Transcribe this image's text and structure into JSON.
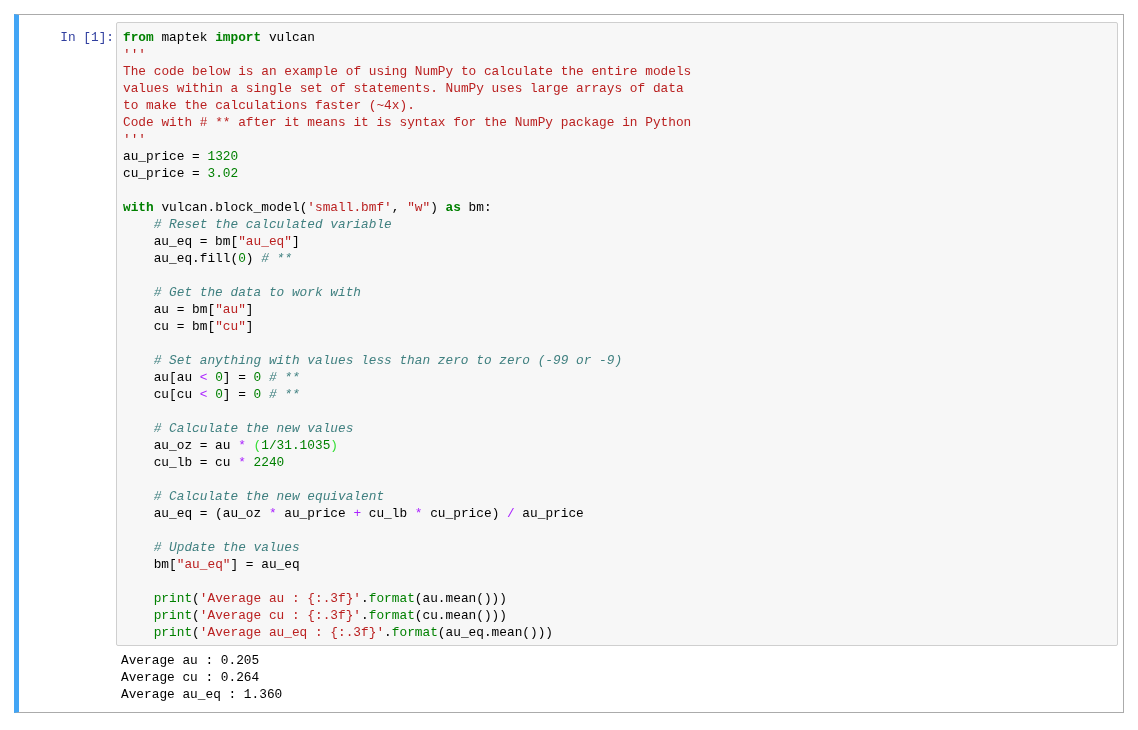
{
  "cell": {
    "prompt": "In [1]:",
    "code_blocks": [
      {
        "lines": [
          {
            "indented": false,
            "tokens": [
              {
                "kind": "keyword",
                "text": "from"
              },
              {
                "kind": "plain",
                "text": " maptek "
              },
              {
                "kind": "keyword",
                "text": "import"
              },
              {
                "kind": "plain",
                "text": " vulcan"
              }
            ]
          },
          {
            "indented": false,
            "tokens": [
              {
                "kind": "string",
                "text": "'''"
              }
            ]
          },
          {
            "indented": false,
            "tokens": [
              {
                "kind": "string",
                "text": "The code below is an example of using NumPy to calculate the entire models"
              }
            ]
          },
          {
            "indented": false,
            "tokens": [
              {
                "kind": "string",
                "text": "values within a single set of statements. NumPy uses large arrays of data"
              }
            ]
          },
          {
            "indented": false,
            "tokens": [
              {
                "kind": "string",
                "text": "to make the calculations faster (~4x)."
              }
            ]
          },
          {
            "indented": false,
            "tokens": [
              {
                "kind": "string",
                "text": "Code with # ** after it means it is syntax for the NumPy package in Python"
              }
            ]
          },
          {
            "indented": false,
            "tokens": [
              {
                "kind": "string",
                "text": "'''"
              }
            ]
          },
          {
            "indented": false,
            "tokens": [
              {
                "kind": "plain",
                "text": "au_price = "
              },
              {
                "kind": "number",
                "text": "1320"
              }
            ]
          },
          {
            "indented": false,
            "tokens": [
              {
                "kind": "plain",
                "text": "cu_price = "
              },
              {
                "kind": "number",
                "text": "3.02"
              }
            ]
          }
        ]
      },
      {
        "lines": [
          {
            "indented": false,
            "tokens": [
              {
                "kind": "keyword",
                "text": "with"
              },
              {
                "kind": "plain",
                "text": " vulcan.block_model("
              },
              {
                "kind": "string",
                "text": "'small.bmf'"
              },
              {
                "kind": "plain",
                "text": ", "
              },
              {
                "kind": "string",
                "text": "\"w\""
              },
              {
                "kind": "plain",
                "text": ") "
              },
              {
                "kind": "keyword",
                "text": "as"
              },
              {
                "kind": "plain",
                "text": " bm:"
              }
            ]
          },
          {
            "indented": true,
            "tokens": [
              {
                "kind": "comment",
                "text": "# Reset the calculated variable"
              }
            ]
          },
          {
            "indented": true,
            "tokens": [
              {
                "kind": "plain",
                "text": "au_eq = bm["
              },
              {
                "kind": "string",
                "text": "\"au_eq\""
              },
              {
                "kind": "plain",
                "text": "]"
              }
            ]
          },
          {
            "indented": true,
            "tokens": [
              {
                "kind": "plain",
                "text": "au_eq.fill("
              },
              {
                "kind": "number",
                "text": "0"
              },
              {
                "kind": "plain",
                "text": ") "
              },
              {
                "kind": "comment",
                "text": "# **"
              }
            ]
          }
        ]
      },
      {
        "lines": [
          {
            "indented": true,
            "tokens": [
              {
                "kind": "comment",
                "text": "# Get the data to work with"
              }
            ]
          },
          {
            "indented": true,
            "tokens": [
              {
                "kind": "plain",
                "text": "au = bm["
              },
              {
                "kind": "string",
                "text": "\"au\""
              },
              {
                "kind": "plain",
                "text": "]"
              }
            ]
          },
          {
            "indented": true,
            "tokens": [
              {
                "kind": "plain",
                "text": "cu = bm["
              },
              {
                "kind": "string",
                "text": "\"cu\""
              },
              {
                "kind": "plain",
                "text": "]"
              }
            ]
          }
        ]
      },
      {
        "lines": [
          {
            "indented": true,
            "tokens": [
              {
                "kind": "comment",
                "text": "# Set anything with values less than zero to zero (-99 or -9)"
              }
            ]
          },
          {
            "indented": true,
            "tokens": [
              {
                "kind": "plain",
                "text": "au[au "
              },
              {
                "kind": "operator",
                "text": "<"
              },
              {
                "kind": "number",
                "text": " 0"
              },
              {
                "kind": "plain",
                "text": "] = "
              },
              {
                "kind": "number",
                "text": "0"
              },
              {
                "kind": "comment",
                "text": " # **"
              }
            ]
          },
          {
            "indented": true,
            "tokens": [
              {
                "kind": "plain",
                "text": "cu[cu "
              },
              {
                "kind": "operator",
                "text": "<"
              },
              {
                "kind": "number",
                "text": " 0"
              },
              {
                "kind": "plain",
                "text": "] = "
              },
              {
                "kind": "number",
                "text": "0"
              },
              {
                "kind": "comment",
                "text": " # **"
              }
            ]
          }
        ]
      },
      {
        "lines": [
          {
            "indented": true,
            "tokens": [
              {
                "kind": "comment",
                "text": "# Calculate the new values"
              }
            ]
          },
          {
            "indented": true,
            "tokens": [
              {
                "kind": "plain",
                "text": "au_oz = au "
              },
              {
                "kind": "operator",
                "text": "*"
              },
              {
                "kind": "bracket",
                "text": " ("
              },
              {
                "kind": "number",
                "text": "1/31.1035"
              },
              {
                "kind": "bracket",
                "text": ")"
              }
            ]
          },
          {
            "indented": true,
            "tokens": [
              {
                "kind": "plain",
                "text": "cu_lb = cu "
              },
              {
                "kind": "operator",
                "text": "*"
              },
              {
                "kind": "number",
                "text": " 2240"
              }
            ]
          }
        ]
      },
      {
        "lines": [
          {
            "indented": true,
            "tokens": [
              {
                "kind": "comment",
                "text": "# Calculate the new equivalent"
              }
            ]
          },
          {
            "indented": true,
            "tokens": [
              {
                "kind": "plain",
                "text": "au_eq = (au_oz "
              },
              {
                "kind": "operator",
                "text": "*"
              },
              {
                "kind": "plain",
                "text": " au_price "
              },
              {
                "kind": "operator",
                "text": "+"
              },
              {
                "kind": "plain",
                "text": " cu_lb "
              },
              {
                "kind": "operator",
                "text": "*"
              },
              {
                "kind": "plain",
                "text": " cu_price) "
              },
              {
                "kind": "operator",
                "text": "/"
              },
              {
                "kind": "plain",
                "text": " au_price"
              }
            ]
          }
        ]
      },
      {
        "lines": [
          {
            "indented": true,
            "tokens": [
              {
                "kind": "comment",
                "text": "# Update the values"
              }
            ]
          },
          {
            "indented": true,
            "tokens": [
              {
                "kind": "plain",
                "text": "bm["
              },
              {
                "kind": "string",
                "text": "\"au_eq\""
              },
              {
                "kind": "plain",
                "text": "] = au_eq"
              }
            ]
          }
        ]
      },
      {
        "lines": [
          {
            "indented": true,
            "tokens": [
              {
                "kind": "builtin",
                "text": "print"
              },
              {
                "kind": "plain",
                "text": "("
              },
              {
                "kind": "string",
                "text": "'Average au : {:.3f}'"
              },
              {
                "kind": "plain",
                "text": "."
              },
              {
                "kind": "builtin",
                "text": "format"
              },
              {
                "kind": "plain",
                "text": "(au.mean()))"
              }
            ]
          },
          {
            "indented": true,
            "tokens": [
              {
                "kind": "builtin",
                "text": "print"
              },
              {
                "kind": "plain",
                "text": "("
              },
              {
                "kind": "string",
                "text": "'Average cu : {:.3f}'"
              },
              {
                "kind": "plain",
                "text": "."
              },
              {
                "kind": "builtin",
                "text": "format"
              },
              {
                "kind": "plain",
                "text": "(cu.mean()))"
              }
            ]
          },
          {
            "indented": true,
            "tokens": [
              {
                "kind": "builtin",
                "text": "print"
              },
              {
                "kind": "plain",
                "text": "("
              },
              {
                "kind": "string",
                "text": "'Average au_eq : {:.3f}'"
              },
              {
                "kind": "plain",
                "text": "."
              },
              {
                "kind": "builtin",
                "text": "format"
              },
              {
                "kind": "plain",
                "text": "(au_eq.mean()))"
              }
            ]
          }
        ]
      }
    ],
    "output_lines": [
      "Average au : 0.205",
      "Average cu : 0.264",
      "Average au_eq : 1.360"
    ]
  }
}
